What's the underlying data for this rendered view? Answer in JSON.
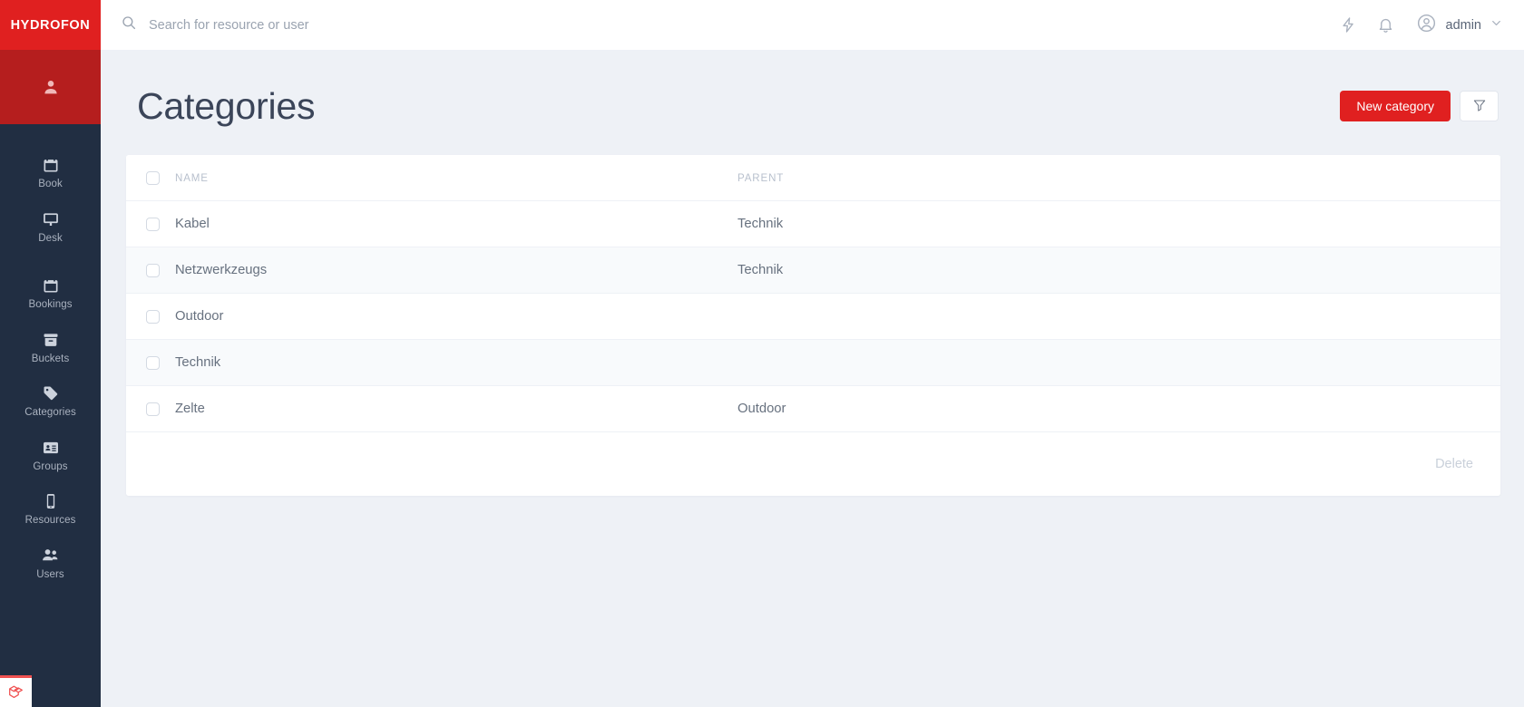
{
  "brand": {
    "name": "HYDROFON"
  },
  "sidebar": {
    "avatar_icon": "user-icon",
    "items": [
      {
        "label": "Book",
        "icon": "calendar-icon"
      },
      {
        "label": "Desk",
        "icon": "monitor-icon"
      },
      {
        "label": "Bookings",
        "icon": "calendar-icon"
      },
      {
        "label": "Buckets",
        "icon": "archive-box-icon"
      },
      {
        "label": "Categories",
        "icon": "tag-icon"
      },
      {
        "label": "Groups",
        "icon": "id-card-icon"
      },
      {
        "label": "Resources",
        "icon": "mobile-icon"
      },
      {
        "label": "Users",
        "icon": "users-icon"
      }
    ],
    "footer_badge_icon": "laravel-logo-icon"
  },
  "topbar": {
    "search": {
      "icon": "search-icon",
      "placeholder": "Search for resource or user",
      "value": ""
    },
    "actions": [
      {
        "icon": "lightning-bolt-icon"
      },
      {
        "icon": "bell-icon"
      }
    ],
    "user": {
      "avatar_icon": "user-circle-icon",
      "name": "admin",
      "chevron_icon": "chevron-down-icon"
    }
  },
  "page": {
    "title": "Categories",
    "new_button_label": "New category",
    "filter_icon": "funnel-icon"
  },
  "table": {
    "columns": [
      "NAME",
      "PARENT"
    ],
    "select_all_checked": false,
    "rows": [
      {
        "name": "Kabel",
        "parent": "Technik"
      },
      {
        "name": "Netzwerkzeugs",
        "parent": "Technik"
      },
      {
        "name": "Outdoor",
        "parent": ""
      },
      {
        "name": "Technik",
        "parent": ""
      },
      {
        "name": "Zelte",
        "parent": "Outdoor"
      }
    ],
    "footer": {
      "delete_label": "Delete",
      "delete_disabled": true
    }
  },
  "colors": {
    "brand_red": "#e02020",
    "brand_red_dark": "#b51e1e",
    "sidebar_navy": "#212e42",
    "page_bg": "#eef1f6",
    "laravel_red": "#f05252"
  }
}
